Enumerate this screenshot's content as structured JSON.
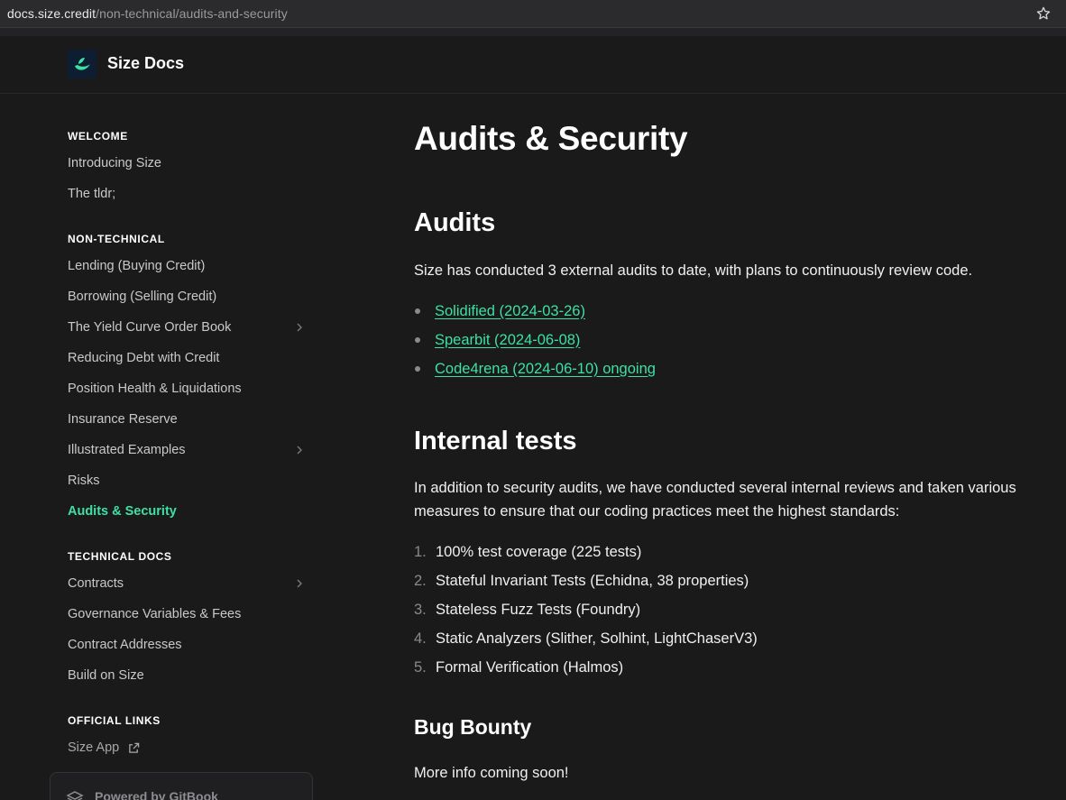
{
  "browser": {
    "url_host": "docs.size.credit",
    "url_path": "/non-technical/audits-and-security"
  },
  "header": {
    "site_name": "Size Docs"
  },
  "sidebar": {
    "sections": [
      {
        "title": "WELCOME",
        "items": [
          "Introducing Size",
          "The tldr;"
        ]
      },
      {
        "title": "NON-TECHNICAL",
        "items": [
          "Lending (Buying Credit)",
          "Borrowing (Selling Credit)",
          "The Yield Curve Order Book",
          "Reducing Debt with Credit",
          "Position Health & Liquidations",
          "Insurance Reserve",
          "Illustrated Examples",
          "Risks",
          "Audits & Security"
        ]
      },
      {
        "title": "TECHNICAL DOCS",
        "items": [
          "Contracts",
          "Governance Variables & Fees",
          "Contract Addresses",
          "Build on Size"
        ]
      },
      {
        "title": "OFFICIAL LINKS",
        "items": [
          "Size App"
        ]
      }
    ],
    "active_item": "Audits & Security",
    "powered_by": "Powered by GitBook"
  },
  "content": {
    "title": "Audits & Security",
    "audits_heading": "Audits",
    "audits_intro": "Size has conducted 3 external audits to date, with plans to continuously review code.",
    "audit_links": [
      "Solidified (2024-03-26)",
      "Spearbit (2024-06-08)",
      "Code4rena (2024-06-10) ongoing"
    ],
    "internal_heading": "Internal tests",
    "internal_intro": "In addition to security audits, we have conducted several internal reviews and taken various measures to ensure that our coding practices meet the highest standards:",
    "internal_list": [
      "100% test coverage (225 tests)",
      "Stateful Invariant Tests (Echidna, 38 properties)",
      "Stateless Fuzz Tests (Foundry)",
      "Static Analyzers (Slither, Solhint, LightChaserV3)",
      "Formal Verification (Halmos)"
    ],
    "bounty_heading": "Bug Bounty",
    "bounty_text": "More info coming soon!"
  },
  "colors": {
    "background": "#1a1a1b",
    "accent": "#3ee0a4",
    "text": "#f0f0f2",
    "muted": "#8a8a8e"
  }
}
